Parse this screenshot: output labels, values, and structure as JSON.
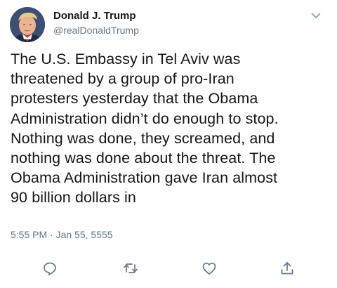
{
  "tweet": {
    "author_name": "Donald J. Trump",
    "author_handle": "@realDonaldTrump",
    "text": "The U.S. Embassy in Tel Aviv was\nthreatened by a group of pro-Iran\nprotesters yesterday that the Obama\nAdministration didn’t do enough to stop.\nNothing was done, they screamed, and\nnothing was done about the threat. The\nObama Administration gave Iran almost\n90 billion dollars in",
    "timestamp": "5:55 PM · Jan 55, 5555"
  },
  "icons": {
    "menu": "chevron-down-icon",
    "reply": "reply-icon",
    "retweet": "retweet-icon",
    "like": "heart-icon",
    "share": "share-icon"
  },
  "colors": {
    "text": "#14171a",
    "secondary": "#657786",
    "icon": "#657786"
  }
}
